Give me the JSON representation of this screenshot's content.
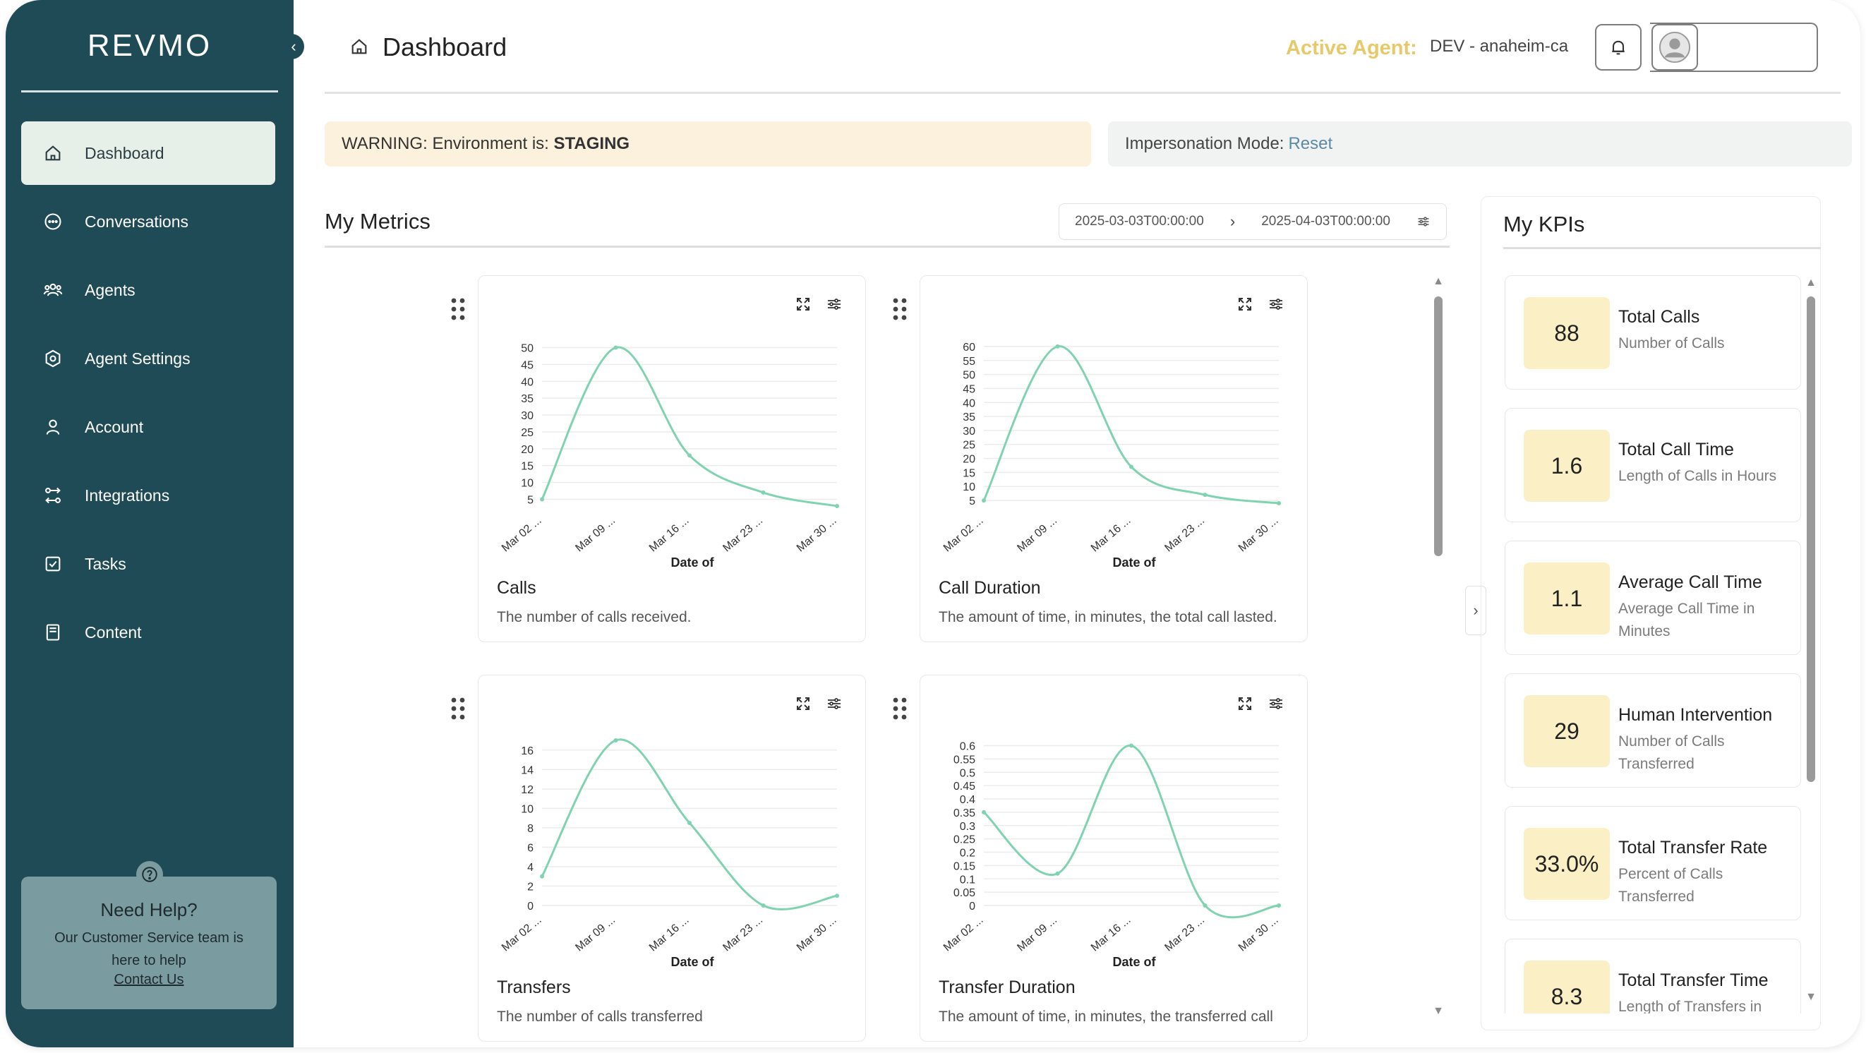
{
  "app": {
    "logo": "REVMO"
  },
  "sidebar": {
    "items": [
      {
        "label": "Dashboard",
        "icon": "home-icon"
      },
      {
        "label": "Conversations",
        "icon": "chat-icon"
      },
      {
        "label": "Agents",
        "icon": "agents-icon"
      },
      {
        "label": "Agent Settings",
        "icon": "gear-icon"
      },
      {
        "label": "Account",
        "icon": "user-icon"
      },
      {
        "label": "Integrations",
        "icon": "integrations-icon"
      },
      {
        "label": "Tasks",
        "icon": "checkbox-icon"
      },
      {
        "label": "Content",
        "icon": "book-icon"
      }
    ],
    "help": {
      "title": "Need Help?",
      "text": "Our Customer Service team is here to help",
      "link": "Contact Us"
    }
  },
  "header": {
    "title": "Dashboard",
    "agent_label": "Active Agent:",
    "agent_value": "DEV - anaheim-ca"
  },
  "banners": {
    "warning_prefix": "WARNING: Environment is:",
    "warning_value": "STAGING",
    "impersonation_label": "Impersonation Mode:",
    "impersonation_link": "Reset"
  },
  "metrics": {
    "title": "My Metrics",
    "date_start": "2025-03-03T00:00:00",
    "date_end": "2025-04-03T00:00:00"
  },
  "colors": {
    "line": "#7fd3b1",
    "sidebar": "#1f4b56",
    "kpi_value_bg": "#fbefc6",
    "active_agent": "#e8c96a"
  },
  "chart_data": [
    {
      "type": "line",
      "title": "Calls",
      "description": "The number of calls received.",
      "xlabel": "Date of",
      "x": [
        "Mar 02 ...",
        "Mar 09 ...",
        "Mar 16 ...",
        "Mar 23 ...",
        "Mar 30 ..."
      ],
      "y": [
        5,
        50,
        18,
        7,
        3
      ],
      "yticks": [
        5,
        10,
        15,
        20,
        25,
        30,
        35,
        40,
        45,
        50
      ],
      "ylim": [
        3,
        52
      ]
    },
    {
      "type": "line",
      "title": "Call Duration",
      "description": "The amount of time, in minutes, the total call lasted.",
      "xlabel": "Date of",
      "x": [
        "Mar 02 ...",
        "Mar 09 ...",
        "Mar 16 ...",
        "Mar 23 ...",
        "Mar 30 ..."
      ],
      "y": [
        5,
        60,
        17,
        7,
        4
      ],
      "yticks": [
        5,
        10,
        15,
        20,
        25,
        30,
        35,
        40,
        45,
        50,
        55,
        60
      ],
      "ylim": [
        3,
        62
      ]
    },
    {
      "type": "line",
      "title": "Transfers",
      "description": "The number of calls transferred",
      "xlabel": "Date of",
      "x": [
        "Mar 02 ...",
        "Mar 09 ...",
        "Mar 16 ...",
        "Mar 23 ...",
        "Mar 30 ..."
      ],
      "y": [
        3,
        17,
        8.5,
        0,
        1
      ],
      "yticks": [
        0,
        2,
        4,
        6,
        8,
        10,
        12,
        14,
        16
      ],
      "ylim": [
        0,
        17
      ]
    },
    {
      "type": "line",
      "title": "Transfer Duration",
      "description": "The amount of time, in minutes, the transferred call",
      "xlabel": "Date of",
      "x": [
        "Mar 02 ...",
        "Mar 09 ...",
        "Mar 16 ...",
        "Mar 23 ...",
        "Mar 30 ..."
      ],
      "y": [
        0.35,
        0.12,
        0.6,
        0,
        0
      ],
      "yticks": [
        0,
        0.05,
        0.1,
        0.15,
        0.2,
        0.25,
        0.3,
        0.35,
        0.4,
        0.45,
        0.5,
        0.55,
        0.6
      ],
      "ylim": [
        0,
        0.62
      ]
    }
  ],
  "kpis": {
    "title": "My KPIs",
    "items": [
      {
        "value": "88",
        "label": "Total Calls",
        "sub": "Number of Calls"
      },
      {
        "value": "1.6",
        "label": "Total Call Time",
        "sub": "Length of Calls in Hours"
      },
      {
        "value": "1.1",
        "label": "Average Call Time",
        "sub": "Average Call Time in Minutes"
      },
      {
        "value": "29",
        "label": "Human Intervention",
        "sub": "Number of Calls Transferred"
      },
      {
        "value": "33.0%",
        "label": "Total Transfer Rate",
        "sub": "Percent of Calls Transferred"
      },
      {
        "value": "8.3",
        "label": "Total Transfer Time",
        "sub": "Length of Transfers in"
      }
    ]
  }
}
